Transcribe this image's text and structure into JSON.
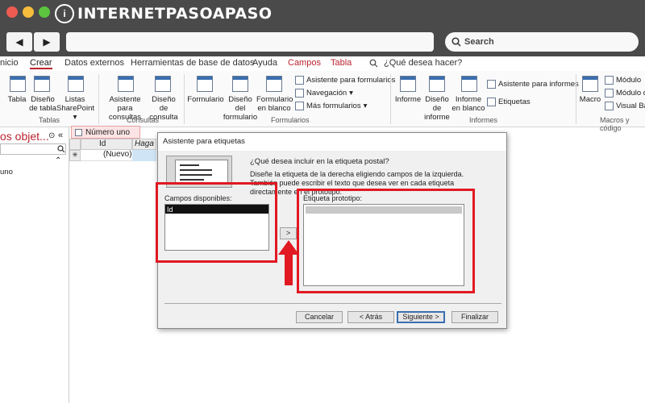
{
  "brand": {
    "logo_text": "INTERNETPASOAPASO",
    "logo_letter": "i"
  },
  "browser": {
    "search_placeholder": "Search",
    "back": "◀",
    "forward": "▶"
  },
  "ribbon_tabs": [
    "nicio",
    "Crear",
    "Datos externos",
    "Herramientas de base de datos",
    "Ayuda",
    "Campos",
    "Tabla"
  ],
  "tell_me": "¿Qué desea hacer?",
  "groups": {
    "tablas": "Tablas",
    "consultas": "Consultas",
    "formularios": "Formularios",
    "informes": "Informes",
    "macros": "Macros y código"
  },
  "buttons": {
    "tabla": "Tabla",
    "diseno_tabla": "Diseño de tabla",
    "listas": "Listas SharePoint",
    "asistente_consultas": "Asistente para consultas",
    "diseno_consulta": "Diseño de consulta",
    "formulario": "Formulario",
    "diseno_formulario": "Diseño del formulario",
    "formulario_blanco": "Formulario en blanco",
    "asistente_formularios": "Asistente para formularios",
    "navegacion": "Navegación",
    "mas_formularios": "Más formularios",
    "informe": "Informe",
    "diseno_informe": "Diseño de informe",
    "informe_blanco": "Informe en blanco",
    "asistente_informes": "Asistente para informes",
    "etiquetas": "Etiquetas",
    "macro": "Macro",
    "modulo": "Módulo",
    "modulo_de": "Módulo de",
    "visual_basic": "Visual Basi"
  },
  "nav": {
    "title": "os objet...",
    "item": "uno"
  },
  "document": {
    "tab": "Número uno",
    "col_id": "Id",
    "col_add": "Haga cl",
    "new_row": "(Nuevo)",
    "row_marker": "✳"
  },
  "dialog": {
    "title": "Asistente para etiquetas",
    "question": "¿Qué desea incluir en la etiqueta postal?",
    "description": "Diseñe la etiqueta de la derecha eligiendo campos de la izquierda. También puede escribir el texto que desea ver en cada etiqueta directamente en el prototipo.",
    "available_label": "Campos disponibles:",
    "available_fields": [
      "Id"
    ],
    "prototype_label": "Etiqueta prototipo:",
    "add_button": ">",
    "cancel": "Cancelar",
    "back": "< Atrás",
    "next": "Siguiente >",
    "finish": "Finalizar"
  },
  "colors": {
    "highlight": "#e11922",
    "chrome": "#4a4a4a",
    "accent_blue": "#3a6fb0"
  }
}
